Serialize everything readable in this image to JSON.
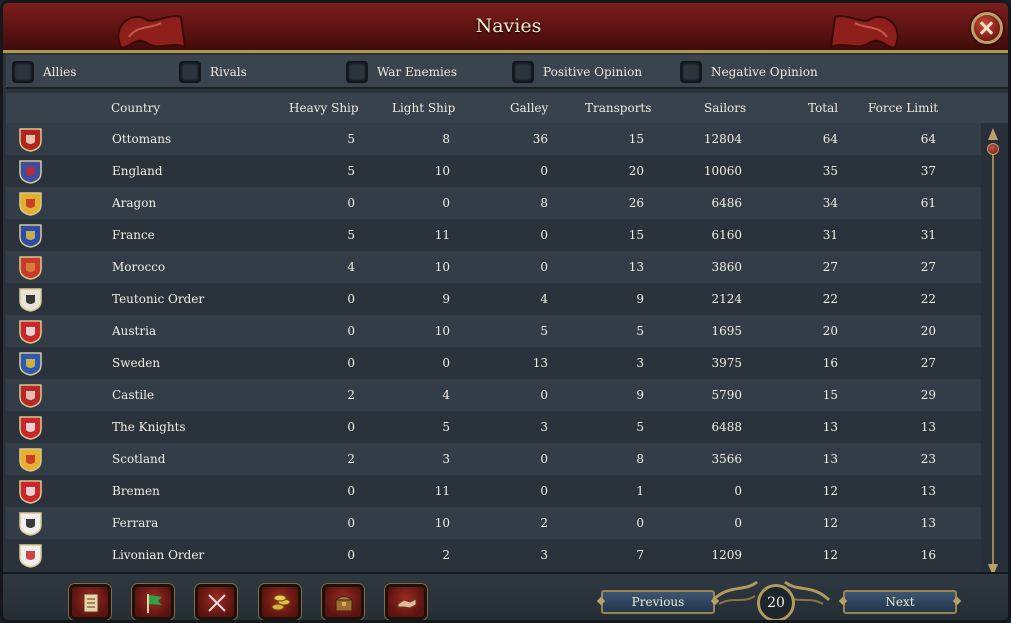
{
  "window": {
    "title": "Navies"
  },
  "filters": [
    {
      "label": "Allies",
      "checked": false
    },
    {
      "label": "Rivals",
      "checked": false
    },
    {
      "label": "War Enemies",
      "checked": false
    },
    {
      "label": "Positive Opinion",
      "checked": false
    },
    {
      "label": "Negative Opinion",
      "checked": false
    }
  ],
  "table": {
    "columns": [
      "Country",
      "Heavy Ship",
      "Light Ship",
      "Galley",
      "Transports",
      "Sailors",
      "Total",
      "Force Limit"
    ],
    "rows": [
      {
        "country": "Ottomans",
        "flag": "ottomans-flag-icon",
        "heavy": "5",
        "light": "8",
        "galley": "36",
        "transports": "15",
        "sailors": "12804",
        "total": "64",
        "force_limit": "64"
      },
      {
        "country": "England",
        "flag": "england-flag-icon",
        "heavy": "5",
        "light": "10",
        "galley": "0",
        "transports": "20",
        "sailors": "10060",
        "total": "35",
        "force_limit": "37"
      },
      {
        "country": "Aragon",
        "flag": "aragon-flag-icon",
        "heavy": "0",
        "light": "0",
        "galley": "8",
        "transports": "26",
        "sailors": "6486",
        "total": "34",
        "force_limit": "61"
      },
      {
        "country": "France",
        "flag": "france-flag-icon",
        "heavy": "5",
        "light": "11",
        "galley": "0",
        "transports": "15",
        "sailors": "6160",
        "total": "31",
        "force_limit": "31"
      },
      {
        "country": "Morocco",
        "flag": "morocco-flag-icon",
        "heavy": "4",
        "light": "10",
        "galley": "0",
        "transports": "13",
        "sailors": "3860",
        "total": "27",
        "force_limit": "27"
      },
      {
        "country": "Teutonic Order",
        "flag": "teutonic-order-flag-icon",
        "heavy": "0",
        "light": "9",
        "galley": "4",
        "transports": "9",
        "sailors": "2124",
        "total": "22",
        "force_limit": "22"
      },
      {
        "country": "Austria",
        "flag": "austria-flag-icon",
        "heavy": "0",
        "light": "10",
        "galley": "5",
        "transports": "5",
        "sailors": "1695",
        "total": "20",
        "force_limit": "20"
      },
      {
        "country": "Sweden",
        "flag": "sweden-flag-icon",
        "heavy": "0",
        "light": "0",
        "galley": "13",
        "transports": "3",
        "sailors": "3975",
        "total": "16",
        "force_limit": "27"
      },
      {
        "country": "Castile",
        "flag": "castile-flag-icon",
        "heavy": "2",
        "light": "4",
        "galley": "0",
        "transports": "9",
        "sailors": "5790",
        "total": "15",
        "force_limit": "29"
      },
      {
        "country": "The Knights",
        "flag": "the-knights-flag-icon",
        "heavy": "0",
        "light": "5",
        "galley": "3",
        "transports": "5",
        "sailors": "6488",
        "total": "13",
        "force_limit": "13"
      },
      {
        "country": "Scotland",
        "flag": "scotland-flag-icon",
        "heavy": "2",
        "light": "3",
        "galley": "0",
        "transports": "8",
        "sailors": "3566",
        "total": "13",
        "force_limit": "23"
      },
      {
        "country": "Bremen",
        "flag": "bremen-flag-icon",
        "heavy": "0",
        "light": "11",
        "galley": "0",
        "transports": "1",
        "sailors": "0",
        "total": "12",
        "force_limit": "13"
      },
      {
        "country": "Ferrara",
        "flag": "ferrara-flag-icon",
        "heavy": "0",
        "light": "10",
        "galley": "2",
        "transports": "0",
        "sailors": "0",
        "total": "12",
        "force_limit": "13"
      },
      {
        "country": "Livonian Order",
        "flag": "livonian-order-flag-icon",
        "heavy": "0",
        "light": "2",
        "galley": "3",
        "transports": "7",
        "sailors": "1209",
        "total": "12",
        "force_limit": "16"
      }
    ]
  },
  "footer": {
    "tools": [
      "ledger-icon",
      "flag-icon",
      "crossed-swords-icon",
      "coins-icon",
      "chest-icon",
      "handshake-icon"
    ],
    "previous_label": "Previous",
    "next_label": "Next",
    "page_number": "20"
  },
  "colors": {
    "title_bar": "#5a1211",
    "accent_gold": "#b0974e",
    "row_odd": "#333d47",
    "row_even": "#2a333c"
  }
}
